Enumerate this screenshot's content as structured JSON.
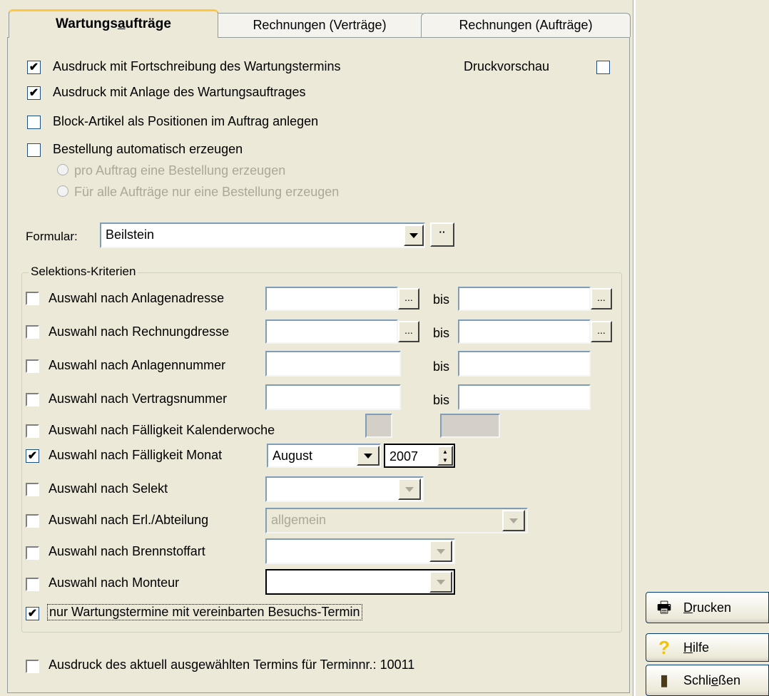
{
  "tabs": [
    "Wartungsaufträge",
    "Rechnungen (Verträge)",
    "Rechnungen (Aufträge)"
  ],
  "options": {
    "fortschreibung": {
      "label": "Ausdruck mit Fortschreibung des Wartungstermins",
      "checked": true
    },
    "druckvorschau": {
      "label": "Druckvorschau",
      "checked": false
    },
    "anlage": {
      "label": "Ausdruck mit Anlage des Wartungsauftrages",
      "checked": true
    },
    "block": {
      "label": "Block-Artikel als Positionen im Auftrag anlegen",
      "checked": false
    },
    "bestellung": {
      "label": "Bestellung automatisch erzeugen",
      "checked": false
    },
    "radio1": "pro Auftrag eine Bestellung erzeugen",
    "radio2": "Für alle Aufträge nur eine Bestellung erzeugen"
  },
  "formular": {
    "label": "Formular:",
    "value": "Beilstein",
    "dots": "··"
  },
  "selektion": {
    "legend": "Selektions-Kriterien",
    "bis": "bis",
    "ellipsis": "...",
    "rows": [
      {
        "label": "Auswahl nach Anlagenadresse",
        "checked": false
      },
      {
        "label": "Auswahl nach Rechnungdresse",
        "checked": false
      },
      {
        "label": "Auswahl nach Anlagennummer",
        "checked": false
      },
      {
        "label": "Auswahl nach Vertragsnummer",
        "checked": false
      },
      {
        "label": "Auswahl nach Fälligkeit Kalenderwoche",
        "checked": false
      },
      {
        "label": "Auswahl nach Fälligkeit Monat",
        "checked": true
      },
      {
        "label": "Auswahl nach Selekt",
        "checked": false
      },
      {
        "label": "Auswahl nach Erl./Abteilung",
        "checked": false
      },
      {
        "label": "Auswahl nach Brennstoffart",
        "checked": false
      },
      {
        "label": "Auswahl nach Monteur",
        "checked": false
      }
    ],
    "month": "August",
    "year": "2007",
    "abteilung": "allgemein",
    "besuchs": {
      "label": "nur Wartungstermine mit vereinbarten Besuchs-Termin",
      "checked": true
    },
    "termin": {
      "label": "Ausdruck des aktuell ausgewählten Termins für Terminnr.: 10011",
      "checked": false
    }
  },
  "buttons": {
    "drucken": "Drucken",
    "hilfe": "Hilfe",
    "schliessen": "Schließen"
  },
  "icons": {
    "printer": "printer-icon",
    "help": "question-icon",
    "exit": "exit-door-icon"
  }
}
